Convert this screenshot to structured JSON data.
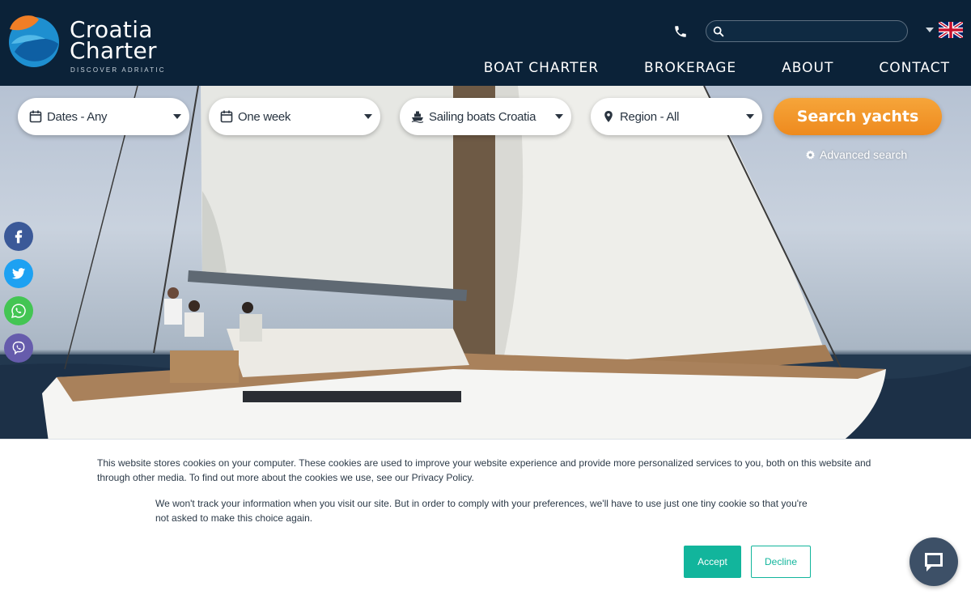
{
  "brand": {
    "name_line1": "Croatia",
    "name_line2": "Charter",
    "tagline": "DISCOVER ADRIATIC",
    "logo_colors": [
      "#f07e26",
      "#1e8fd0",
      "#0e5fa3"
    ]
  },
  "header": {
    "phone_icon": "phone-icon",
    "search_placeholder": "",
    "language": "English",
    "nav": [
      "BOAT CHARTER",
      "BROKERAGE",
      "ABOUT",
      "CONTACT"
    ]
  },
  "filters": {
    "dates": "Dates - Any",
    "duration": "One week",
    "boat_type": "Sailing boats Croatia",
    "region": "Region - All",
    "search_button": "Search yachts",
    "advanced": "Advanced search"
  },
  "social": [
    {
      "name": "facebook",
      "color": "#3b5998"
    },
    {
      "name": "twitter",
      "color": "#1da1f2"
    },
    {
      "name": "whatsapp",
      "color": "#43c553"
    },
    {
      "name": "viber",
      "color": "#665cac"
    }
  ],
  "cookie": {
    "text1": "This website stores cookies on your computer. These cookies are used to improve your website experience and provide more personalized services to you, both on this website and through other media. To find out more about the cookies we use, see our Privacy Policy.",
    "text2": "We won't track your information when you visit our site. But in order to comply with your preferences, we'll have to use just one tiny cookie so that you're not asked to make this choice again.",
    "accept": "Accept",
    "decline": "Decline"
  },
  "colors": {
    "header_bg": "#0b2238",
    "accent_orange": "#f0921f",
    "accept_green": "#12b59c"
  }
}
